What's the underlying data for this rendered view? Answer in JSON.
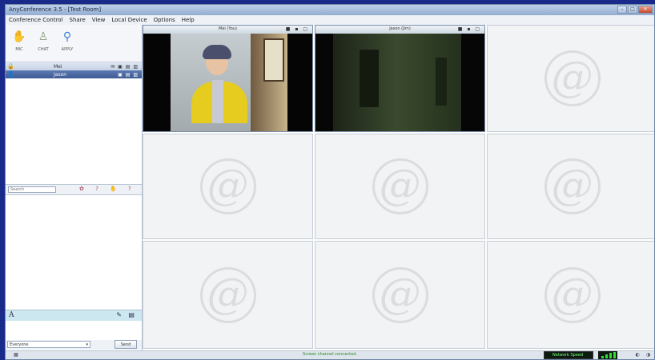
{
  "window": {
    "title": "AnyConference 3.5 - [Test Room]",
    "buttons": [
      "–",
      "□",
      "✕"
    ]
  },
  "menu": [
    "Conference Control",
    "Share",
    "View",
    "Local Device",
    "Options",
    "Help"
  ],
  "status_toolbar": {
    "buttons": [
      {
        "label": "MIC",
        "icon": "hand-icon"
      },
      {
        "label": "CHAT",
        "icon": "person-icon"
      },
      {
        "label": "APPLY",
        "icon": "pin-person-icon"
      }
    ]
  },
  "users": [
    {
      "name": "Mei",
      "icon": "🔒",
      "tools": "✉ ▣ ▤ ▥"
    },
    {
      "name": "Jason",
      "icon": "👤",
      "tools": "▣ ▤ ▥"
    }
  ],
  "search": {
    "placeholder": "Search",
    "tools": "✿ ?  ✋ ?"
  },
  "chat": {
    "font_icon": "A",
    "tools": "✎ ▤",
    "target": "Everyone",
    "send_label": "Send"
  },
  "video_cells": [
    {
      "title": "Mei (You)",
      "tools": "■ ▪ ▢",
      "state": "live-woman"
    },
    {
      "title": "Jason (Jim)",
      "tools": "■ ▪ ▢",
      "state": "live-room"
    },
    {
      "title": "",
      "tools": "",
      "state": "empty"
    },
    {
      "title": "",
      "tools": "",
      "state": "empty"
    },
    {
      "title": "",
      "tools": "",
      "state": "empty"
    },
    {
      "title": "",
      "tools": "",
      "state": "empty"
    },
    {
      "title": "",
      "tools": "",
      "state": "empty"
    },
    {
      "title": "",
      "tools": "",
      "state": "empty"
    },
    {
      "title": "",
      "tools": "",
      "state": "empty"
    }
  ],
  "empty_logo": "@",
  "statusbar": {
    "text": "Screen channel connected.",
    "network_text": "Network Speed",
    "left_icon": "▦",
    "right_icons": "◐ ◑"
  }
}
